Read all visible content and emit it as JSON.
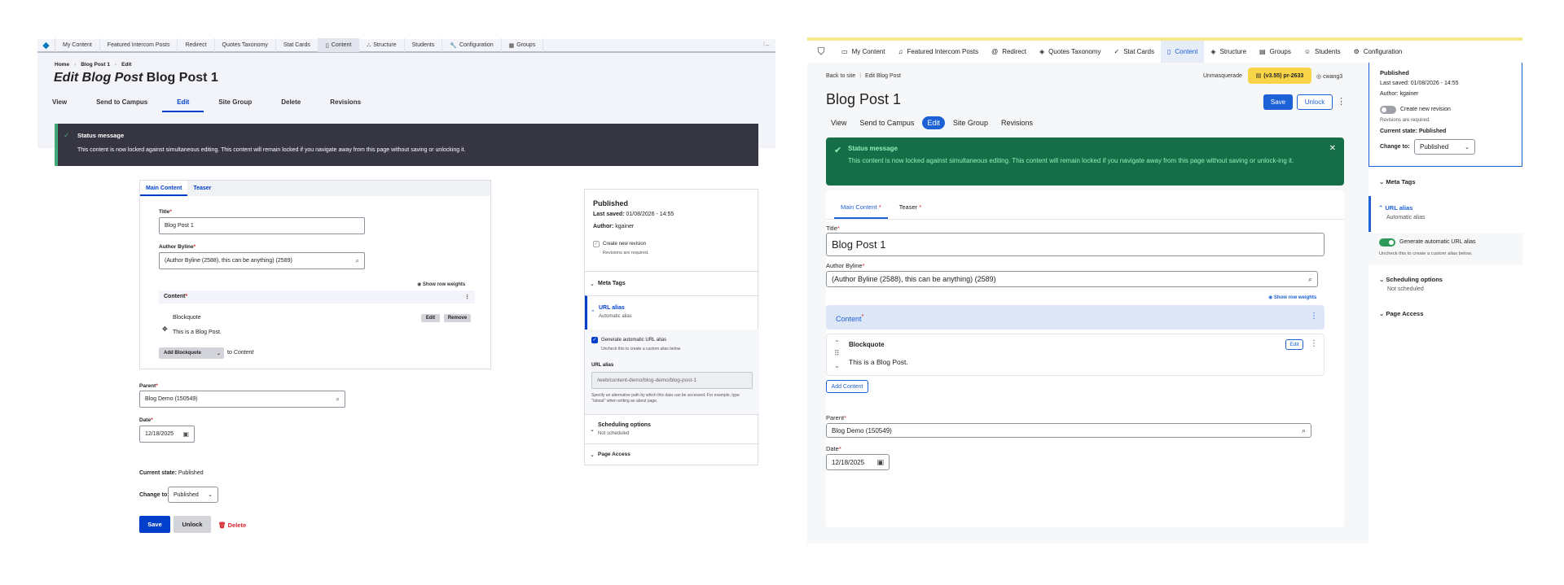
{
  "left": {
    "toolbar": {
      "items": [
        "My Content",
        "Featured Intercom Posts",
        "Redirect",
        "Quotes Taxonomy",
        "Stat Cards",
        "Content",
        "Structure",
        "Students",
        "Configuration",
        "Groups"
      ],
      "right_icon": "⁞↔"
    },
    "breadcrumb": [
      "Home",
      "Blog Post 1",
      "Edit"
    ],
    "title_prefix": "Edit Blog Post",
    "title": "Blog Post 1",
    "tabs": [
      "View",
      "Send to Campus",
      "Edit",
      "Site Group",
      "Delete",
      "Revisions"
    ],
    "status": {
      "heading": "Status message",
      "message": "This content is now locked against simultaneous editing. This content will remain locked if you navigate away from this page without saving or unlocking it."
    },
    "form_tabs": [
      "Main Content",
      "Teaser"
    ],
    "title_label": "Title",
    "title_value": "Blog Post 1",
    "author_label": "Author Byline",
    "author_value": "(Author Byline (2588), this can be anything) (2589)",
    "show_row_weights": "Show row weights",
    "content_label": "Content",
    "paragraph_type": "Blockquote",
    "edit_btn": "Edit",
    "remove_btn": "Remove",
    "paragraph_text": "This is a Blog Post.",
    "add_btn": "Add Blockquote",
    "add_to": "to",
    "add_target": "Content",
    "parent_label": "Parent",
    "parent_value": "Blog Demo (150549)",
    "date_label": "Date",
    "date_value": "12/18/2025",
    "current_state_label": "Current state:",
    "current_state_value": "Published",
    "change_to_label": "Change to:",
    "change_to_value": "Published",
    "save": "Save",
    "unlock": "Unlock",
    "delete": "Delete",
    "sidebar": {
      "status": "Published",
      "last_saved_label": "Last saved:",
      "last_saved": "01/08/2026 - 14:55",
      "author_label": "Author:",
      "author": "kgainer",
      "create_revision": "Create new revision",
      "revisions_required": "Revisions are required.",
      "meta_tags": "Meta Tags",
      "url_alias": "URL alias",
      "automatic_alias": "Automatic alias",
      "generate_alias": "Generate automatic URL alias",
      "uncheck_hint": "Uncheck this to create a custom alias below.",
      "url_alias_label": "URL alias",
      "url_alias_value": "/web/content-demo/blog-demo/blog-post-1",
      "alias_help": "Specify an alternative path by which this data can be accessed. For example, type \"/about\" when writing an about page.",
      "scheduling": "Scheduling options",
      "not_scheduled": "Not scheduled",
      "page_access": "Page Access"
    }
  },
  "right": {
    "toolbar": {
      "items": [
        "My Content",
        "Featured Intercom Posts",
        "Redirect",
        "Quotes Taxonomy",
        "Stat Cards",
        "Content",
        "Structure",
        "Groups",
        "Students",
        "Configuration"
      ]
    },
    "breadcrumb": [
      "Back to site",
      "Edit Blog Post"
    ],
    "unmasquerade": "Unmasquerade",
    "env_badge": "(v3.55) pr-2633",
    "user": "cwang3",
    "title": "Blog Post 1",
    "save": "Save",
    "unlock": "Unlock",
    "tabs": [
      "View",
      "Send to Campus",
      "Edit",
      "Site Group",
      "Revisions"
    ],
    "status": {
      "heading": "Status message",
      "message": "This content is now locked against simultaneous editing. This content will remain locked if you navigate away from this page without saving or unlock-ing it."
    },
    "form_tabs": [
      "Main Content",
      "Teaser"
    ],
    "title_label": "Title",
    "title_value": "Blog Post 1",
    "author_label": "Author Byline",
    "author_value": "(Author Byline (2588), this can be anything) (2589)",
    "show_row_weights": "Show row weights",
    "content_label": "Content",
    "paragraph_type": "Blockquote",
    "edit_btn": "Edit",
    "paragraph_text": "This is a Blog Post.",
    "add_content": "Add Content",
    "parent_label": "Parent",
    "parent_value": "Blog Demo (150549)",
    "date_label": "Date",
    "date_value": "12/18/2025",
    "sidebar": {
      "status": "Published",
      "last_saved": "Last saved: 01/08/2026 - 14:55",
      "author": "Author: kgainer",
      "create_revision": "Create new revision",
      "revisions_required": "Revisions are required.",
      "current_state": "Current state: Published",
      "change_to_label": "Change to:",
      "change_to_value": "Published",
      "meta_tags": "Meta Tags",
      "url_alias": "URL alias",
      "automatic_alias": "Automatic alias",
      "generate_alias": "Generate automatic URL alias",
      "uncheck_hint": "Uncheck this to create a custom alias below.",
      "scheduling": "Scheduling options",
      "not_scheduled": "Not scheduled",
      "page_access": "Page Access"
    }
  },
  "colors": {
    "claro_blue": "#003ecc",
    "gin_blue": "#1d61d6",
    "status_dark": "#353641",
    "gin_status": "#166e48",
    "env_yellow": "#f8d548"
  }
}
